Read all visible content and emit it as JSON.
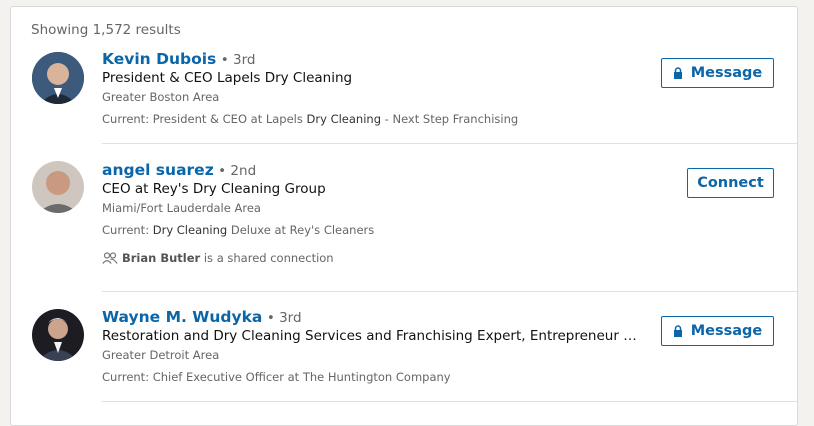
{
  "summary": {
    "showing": "Showing 1,572 results"
  },
  "results": [
    {
      "name": "Kevin Dubois",
      "degree": "• 3rd",
      "headline": "President & CEO Lapels Dry Cleaning",
      "location": "Greater Boston Area",
      "current_prefix": "Current: President & CEO at Lapels ",
      "current_highlight": "Dry Cleaning",
      "current_suffix": " - Next Step Franchising",
      "action": "Message",
      "action_icon": "lock-icon"
    },
    {
      "name": "angel suarez",
      "degree": "• 2nd",
      "headline": "CEO at Rey's Dry Cleaning Group",
      "location": "Miami/Fort Lauderdale Area",
      "current_prefix": "Current: ",
      "current_highlight": "Dry Cleaning",
      "current_suffix": " Deluxe at Rey's Cleaners",
      "shared_name": "Brian Butler",
      "shared_text": " is a shared connection",
      "action": "Connect"
    },
    {
      "name": "Wayne M. Wudyka",
      "degree": "• 3rd",
      "headline": "Restoration and Dry Cleaning Services and Franchising Expert, Entrepreneur and C…",
      "location": "Greater Detroit Area",
      "current_prefix": "Current: Chief Executive Officer at The Huntington Company",
      "current_highlight": "",
      "current_suffix": "",
      "action": "Message",
      "action_icon": "lock-icon"
    }
  ]
}
